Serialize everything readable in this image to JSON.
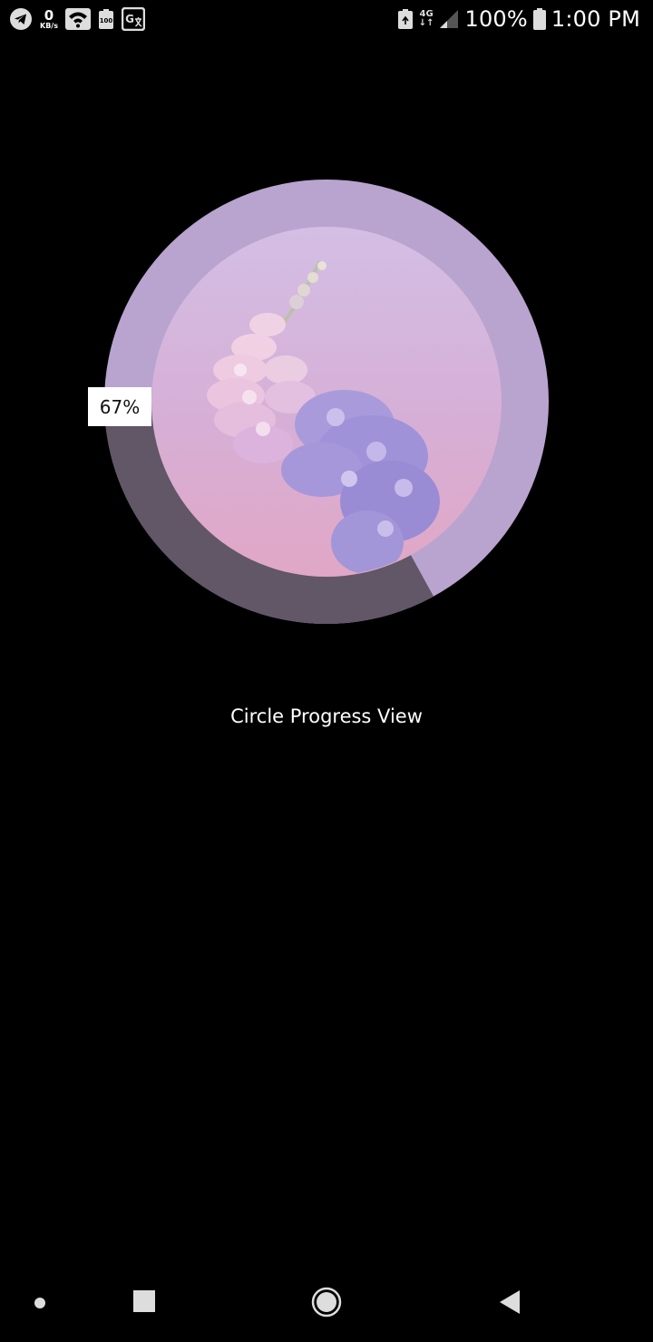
{
  "status_bar": {
    "left_icons": [
      "telegram-icon",
      "wifi-icon",
      "battery-saver-icon",
      "translate-icon"
    ],
    "network_speed_value": "0",
    "network_speed_unit": "KB/s",
    "battery_small_text": "100",
    "network_type": "4G",
    "battery_percent": "100%",
    "time": "1:00 PM"
  },
  "progress_view": {
    "progress_percent": 67,
    "label": "67%",
    "ring_color": "#B8A4CF",
    "remaining_color": "#615766",
    "caption": "Circle Progress View"
  },
  "nav_bar": {
    "buttons": [
      "menu-dot-icon",
      "recents-square-icon",
      "home-circle-icon",
      "back-triangle-icon"
    ]
  }
}
